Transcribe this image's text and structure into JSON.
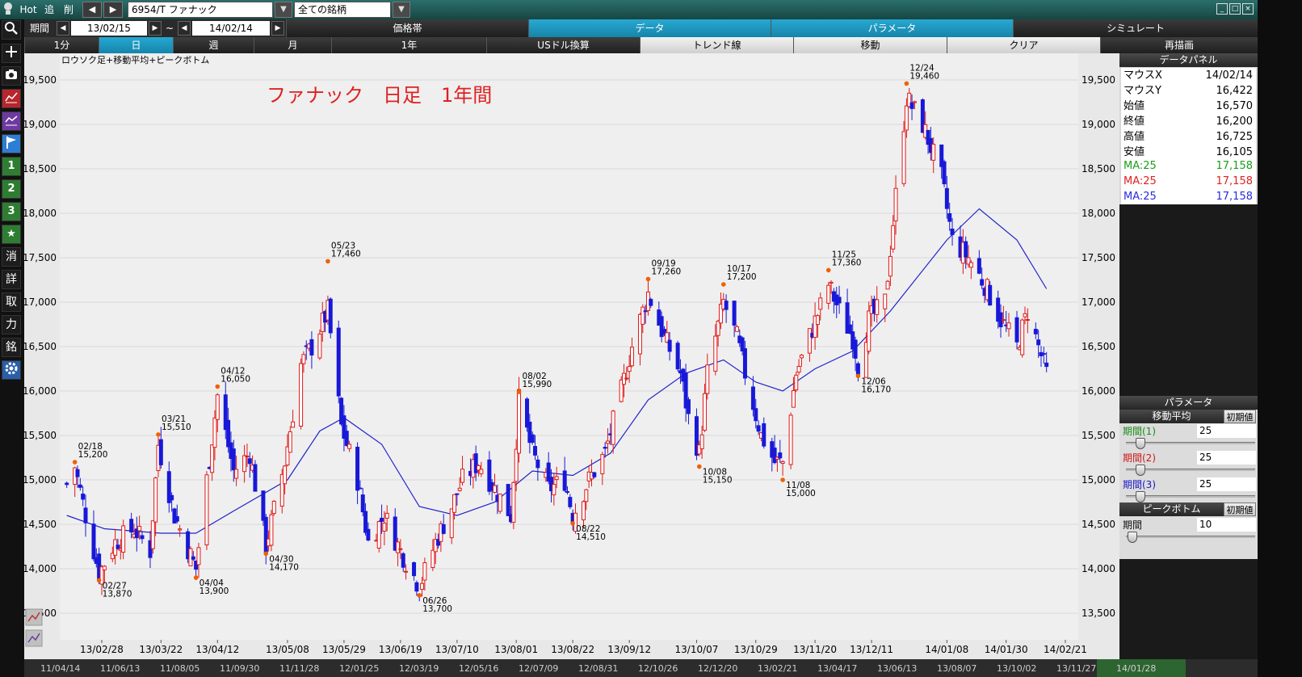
{
  "topbar": {
    "hot": "Hot",
    "add": "追",
    "del": "削",
    "symbol": "6954/T ファナック",
    "market": "全ての銘柄"
  },
  "row2": {
    "period_label": "期間",
    "from_date": "13/02/15",
    "tilde": "~",
    "to_date": "14/02/14",
    "tabs": [
      "価格帯",
      "データ",
      "パラメータ",
      "シミュレート"
    ]
  },
  "row3": {
    "buttons": [
      "1分",
      "日",
      "週",
      "月",
      "1年",
      "USドル換算",
      "トレンド線",
      "移動",
      "クリア",
      "再描画"
    ]
  },
  "leftbar": {
    "icons": [
      "search-icon",
      "plus-icon",
      "camera-icon",
      "line-chart-icon",
      "area-chart-icon",
      "flag-icon"
    ],
    "buttons": [
      "1",
      "2",
      "3",
      "★",
      "消",
      "詳",
      "取",
      "力",
      "銘"
    ]
  },
  "chart": {
    "subtitle": "ロウソク足+移動平均+ピークボトム",
    "title": "ファナック　日足　1年間",
    "x_labels": [
      "13/02/28",
      "13/03/22",
      "13/04/12",
      "13/05/08",
      "13/05/29",
      "13/06/19",
      "13/07/10",
      "13/08/01",
      "13/08/22",
      "13/09/12",
      "13/10/07",
      "13/10/29",
      "13/11/20",
      "13/12/11",
      "14/01/08",
      "14/01/30",
      "14/02/21"
    ],
    "y_labels": [
      "19,500",
      "19,000",
      "18,500",
      "18,000",
      "17,500",
      "17,000",
      "16,500",
      "16,000",
      "15,500",
      "15,000",
      "14,500",
      "14,000",
      "13,500"
    ],
    "peaks": [
      {
        "date": "02/18",
        "value": "15,200"
      },
      {
        "date": "02/27",
        "value": "13,870"
      },
      {
        "date": "03/21",
        "value": "15,510"
      },
      {
        "date": "04/04",
        "value": "13,900"
      },
      {
        "date": "04/12",
        "value": "16,050"
      },
      {
        "date": "04/30",
        "value": "14,170"
      },
      {
        "date": "05/23",
        "value": "17,460"
      },
      {
        "date": "06/26",
        "value": "13,700"
      },
      {
        "date": "08/02",
        "value": "15,990"
      },
      {
        "date": "08/22",
        "value": "14,510"
      },
      {
        "date": "09/19",
        "value": "17,260"
      },
      {
        "date": "10/08",
        "value": "15,150"
      },
      {
        "date": "10/17",
        "value": "17,200"
      },
      {
        "date": "11/08",
        "value": "15,000"
      },
      {
        "date": "11/25",
        "value": "17,360"
      },
      {
        "date": "12/06",
        "value": "16,170"
      },
      {
        "date": "12/24",
        "value": "19,460"
      }
    ],
    "bottom_axis": [
      "11/04/14",
      "11/06/13",
      "11/08/05",
      "11/09/30",
      "11/11/28",
      "12/01/25",
      "12/03/19",
      "12/05/16",
      "12/07/09",
      "12/08/31",
      "12/10/26",
      "12/12/20",
      "13/02/21",
      "13/04/17",
      "13/06/13",
      "13/08/07",
      "13/10/02",
      "13/11/27",
      "14/01/28"
    ]
  },
  "data_panel": {
    "title": "データパネル",
    "rows": [
      {
        "k": "マウスX",
        "v": "14/02/14"
      },
      {
        "k": "マウスY",
        "v": "16,422"
      },
      {
        "k": "始値",
        "v": "16,570"
      },
      {
        "k": "終値",
        "v": "16,200"
      },
      {
        "k": "高値",
        "v": "16,725"
      },
      {
        "k": "安値",
        "v": "16,105"
      }
    ],
    "ma_rows": [
      {
        "k": "MA:25",
        "v": "17,158",
        "color": "#1a9e1a"
      },
      {
        "k": "MA:25",
        "v": "17,158",
        "color": "#e02020"
      },
      {
        "k": "MA:25",
        "v": "17,158",
        "color": "#2a2ae0"
      }
    ]
  },
  "param_panel": {
    "title": "パラメータ",
    "ma_title": "移動平均",
    "init_label": "初期値",
    "periods": [
      {
        "label": "期間(1)",
        "value": "25",
        "color": "#1a8a1a",
        "level": 0.1
      },
      {
        "label": "期間(2)",
        "value": "25",
        "color": "#d01818",
        "level": 0.1
      },
      {
        "label": "期間(3)",
        "value": "25",
        "color": "#1818c8",
        "level": 0.1
      }
    ],
    "pb_title": "ピークボトム",
    "pb_period_label": "期間",
    "pb_period_value": "10",
    "pb_level": 0.0
  },
  "chart_data": {
    "type": "candlestick",
    "title": "ファナック　日足　1年間",
    "ylim": [
      13200,
      19800
    ],
    "moving_average_period": 25,
    "peak_bottom": [
      {
        "date": "2013-02-18",
        "value": 15200,
        "kind": "peak"
      },
      {
        "date": "2013-02-27",
        "value": 13870,
        "kind": "bottom"
      },
      {
        "date": "2013-03-21",
        "value": 15510,
        "kind": "peak"
      },
      {
        "date": "2013-04-04",
        "value": 13900,
        "kind": "bottom"
      },
      {
        "date": "2013-04-12",
        "value": 16050,
        "kind": "peak"
      },
      {
        "date": "2013-04-30",
        "value": 14170,
        "kind": "bottom"
      },
      {
        "date": "2013-05-23",
        "value": 17460,
        "kind": "peak"
      },
      {
        "date": "2013-06-26",
        "value": 13700,
        "kind": "bottom"
      },
      {
        "date": "2013-08-02",
        "value": 15990,
        "kind": "peak"
      },
      {
        "date": "2013-08-22",
        "value": 14510,
        "kind": "bottom"
      },
      {
        "date": "2013-09-19",
        "value": 17260,
        "kind": "peak"
      },
      {
        "date": "2013-10-08",
        "value": 15150,
        "kind": "bottom"
      },
      {
        "date": "2013-10-17",
        "value": 17200,
        "kind": "peak"
      },
      {
        "date": "2013-11-08",
        "value": 15000,
        "kind": "bottom"
      },
      {
        "date": "2013-11-25",
        "value": 17360,
        "kind": "peak"
      },
      {
        "date": "2013-12-06",
        "value": 16170,
        "kind": "bottom"
      },
      {
        "date": "2013-12-24",
        "value": 19460,
        "kind": "peak"
      }
    ],
    "close_path": [
      [
        "2013-02-15",
        14950
      ],
      [
        "2013-02-18",
        15150
      ],
      [
        "2013-02-22",
        14600
      ],
      [
        "2013-02-27",
        13950
      ],
      [
        "2013-03-05",
        14300
      ],
      [
        "2013-03-12",
        14450
      ],
      [
        "2013-03-18",
        14200
      ],
      [
        "2013-03-21",
        15400
      ],
      [
        "2013-03-27",
        14600
      ],
      [
        "2013-04-04",
        14000
      ],
      [
        "2013-04-08",
        15000
      ],
      [
        "2013-04-12",
        15950
      ],
      [
        "2013-04-18",
        15100
      ],
      [
        "2013-04-24",
        15300
      ],
      [
        "2013-04-30",
        14250
      ],
      [
        "2013-05-07",
        15200
      ],
      [
        "2013-05-13",
        16300
      ],
      [
        "2013-05-17",
        16500
      ],
      [
        "2013-05-23",
        16900
      ],
      [
        "2013-05-28",
        15600
      ],
      [
        "2013-06-03",
        15000
      ],
      [
        "2013-06-07",
        14300
      ],
      [
        "2013-06-13",
        14600
      ],
      [
        "2013-06-19",
        14200
      ],
      [
        "2013-06-26",
        13800
      ],
      [
        "2013-07-02",
        14300
      ],
      [
        "2013-07-08",
        14700
      ],
      [
        "2013-07-12",
        15000
      ],
      [
        "2013-07-18",
        15200
      ],
      [
        "2013-07-24",
        14900
      ],
      [
        "2013-07-30",
        14600
      ],
      [
        "2013-08-02",
        15900
      ],
      [
        "2013-08-07",
        15300
      ],
      [
        "2013-08-13",
        14900
      ],
      [
        "2013-08-19",
        15000
      ],
      [
        "2013-08-22",
        14600
      ],
      [
        "2013-08-28",
        15000
      ],
      [
        "2013-09-03",
        15300
      ],
      [
        "2013-09-09",
        16000
      ],
      [
        "2013-09-13",
        16500
      ],
      [
        "2013-09-19",
        17100
      ],
      [
        "2013-09-25",
        16600
      ],
      [
        "2013-10-01",
        16200
      ],
      [
        "2013-10-04",
        15700
      ],
      [
        "2013-10-08",
        15300
      ],
      [
        "2013-10-11",
        16200
      ],
      [
        "2013-10-17",
        17000
      ],
      [
        "2013-10-22",
        16600
      ],
      [
        "2013-10-25",
        16200
      ],
      [
        "2013-10-31",
        15500
      ],
      [
        "2013-11-05",
        15200
      ],
      [
        "2013-11-08",
        15200
      ],
      [
        "2013-11-13",
        16200
      ],
      [
        "2013-11-19",
        16700
      ],
      [
        "2013-11-25",
        17200
      ],
      [
        "2013-11-29",
        16900
      ],
      [
        "2013-12-04",
        16600
      ],
      [
        "2013-12-06",
        16300
      ],
      [
        "2013-12-10",
        16800
      ],
      [
        "2013-12-16",
        17000
      ],
      [
        "2013-12-20",
        18200
      ],
      [
        "2013-12-24",
        19300
      ],
      [
        "2013-12-30",
        19000
      ],
      [
        "2014-01-06",
        18400
      ],
      [
        "2014-01-10",
        17700
      ],
      [
        "2014-01-16",
        17500
      ],
      [
        "2014-01-22",
        17200
      ],
      [
        "2014-01-28",
        16800
      ],
      [
        "2014-02-03",
        16500
      ],
      [
        "2014-02-07",
        16900
      ],
      [
        "2014-02-14",
        16200
      ]
    ],
    "ma_path": [
      [
        "2013-02-15",
        14600
      ],
      [
        "2013-03-01",
        14450
      ],
      [
        "2013-03-22",
        14400
      ],
      [
        "2013-04-04",
        14400
      ],
      [
        "2013-04-18",
        14650
      ],
      [
        "2013-05-08",
        15000
      ],
      [
        "2013-05-20",
        15550
      ],
      [
        "2013-05-29",
        15700
      ],
      [
        "2013-06-12",
        15400
      ],
      [
        "2013-06-26",
        14700
      ],
      [
        "2013-07-10",
        14600
      ],
      [
        "2013-07-24",
        14750
      ],
      [
        "2013-08-07",
        15100
      ],
      [
        "2013-08-22",
        15050
      ],
      [
        "2013-09-05",
        15300
      ],
      [
        "2013-09-19",
        15900
      ],
      [
        "2013-10-03",
        16200
      ],
      [
        "2013-10-17",
        16350
      ],
      [
        "2013-10-29",
        16100
      ],
      [
        "2013-11-08",
        16000
      ],
      [
        "2013-11-20",
        16250
      ],
      [
        "2013-12-04",
        16450
      ],
      [
        "2013-12-18",
        16900
      ],
      [
        "2014-01-08",
        17700
      ],
      [
        "2014-01-20",
        18050
      ],
      [
        "2014-02-03",
        17700
      ],
      [
        "2014-02-14",
        17150
      ]
    ]
  }
}
